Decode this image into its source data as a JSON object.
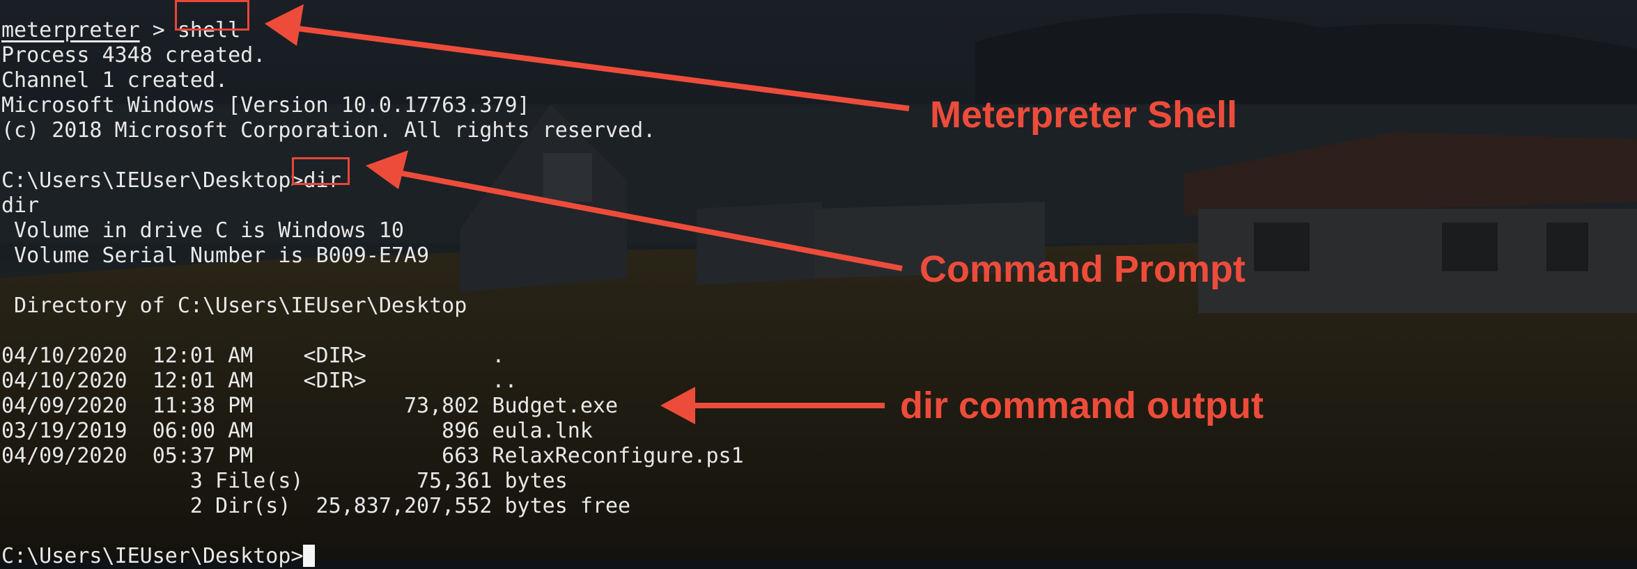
{
  "terminal": {
    "lines": [
      "",
      "> shell",
      "Process 4348 created.",
      "Channel 1 created.",
      "Microsoft Windows [Version 10.0.17763.379]",
      "(c) 2018 Microsoft Corporation. All rights reserved.",
      "",
      "C:\\Users\\IEUser\\Desktop>dir",
      "dir",
      " Volume in drive C is Windows 10",
      " Volume Serial Number is B009-E7A9",
      "",
      " Directory of C:\\Users\\IEUser\\Desktop",
      "",
      "04/10/2020  12:01 AM    <DIR>          .",
      "04/10/2020  12:01 AM    <DIR>          ..",
      "04/09/2020  11:38 PM            73,802 Budget.exe",
      "03/19/2019  06:00 AM               896 eula.lnk",
      "04/09/2020  05:37 PM               663 RelaxReconfigure.ps1",
      "               3 File(s)         75,361 bytes",
      "               2 Dir(s)  25,837,207,552 bytes free",
      "",
      "C:\\Users\\IEUser\\Desktop>"
    ],
    "prompt_name": "meterpreter",
    "prompt_sep": " > ",
    "shell_cmd": "shell",
    "cmd_prompt": "C:\\Users\\IEUser\\Desktop>",
    "dir_cmd": "dir"
  },
  "annotations": {
    "meterpreter_shell": "Meterpreter Shell",
    "command_prompt": "Command Prompt",
    "dir_output": "dir command output"
  },
  "colors": {
    "annotation": "#ee4c3b",
    "terminal_text": "#e8e8e8"
  }
}
